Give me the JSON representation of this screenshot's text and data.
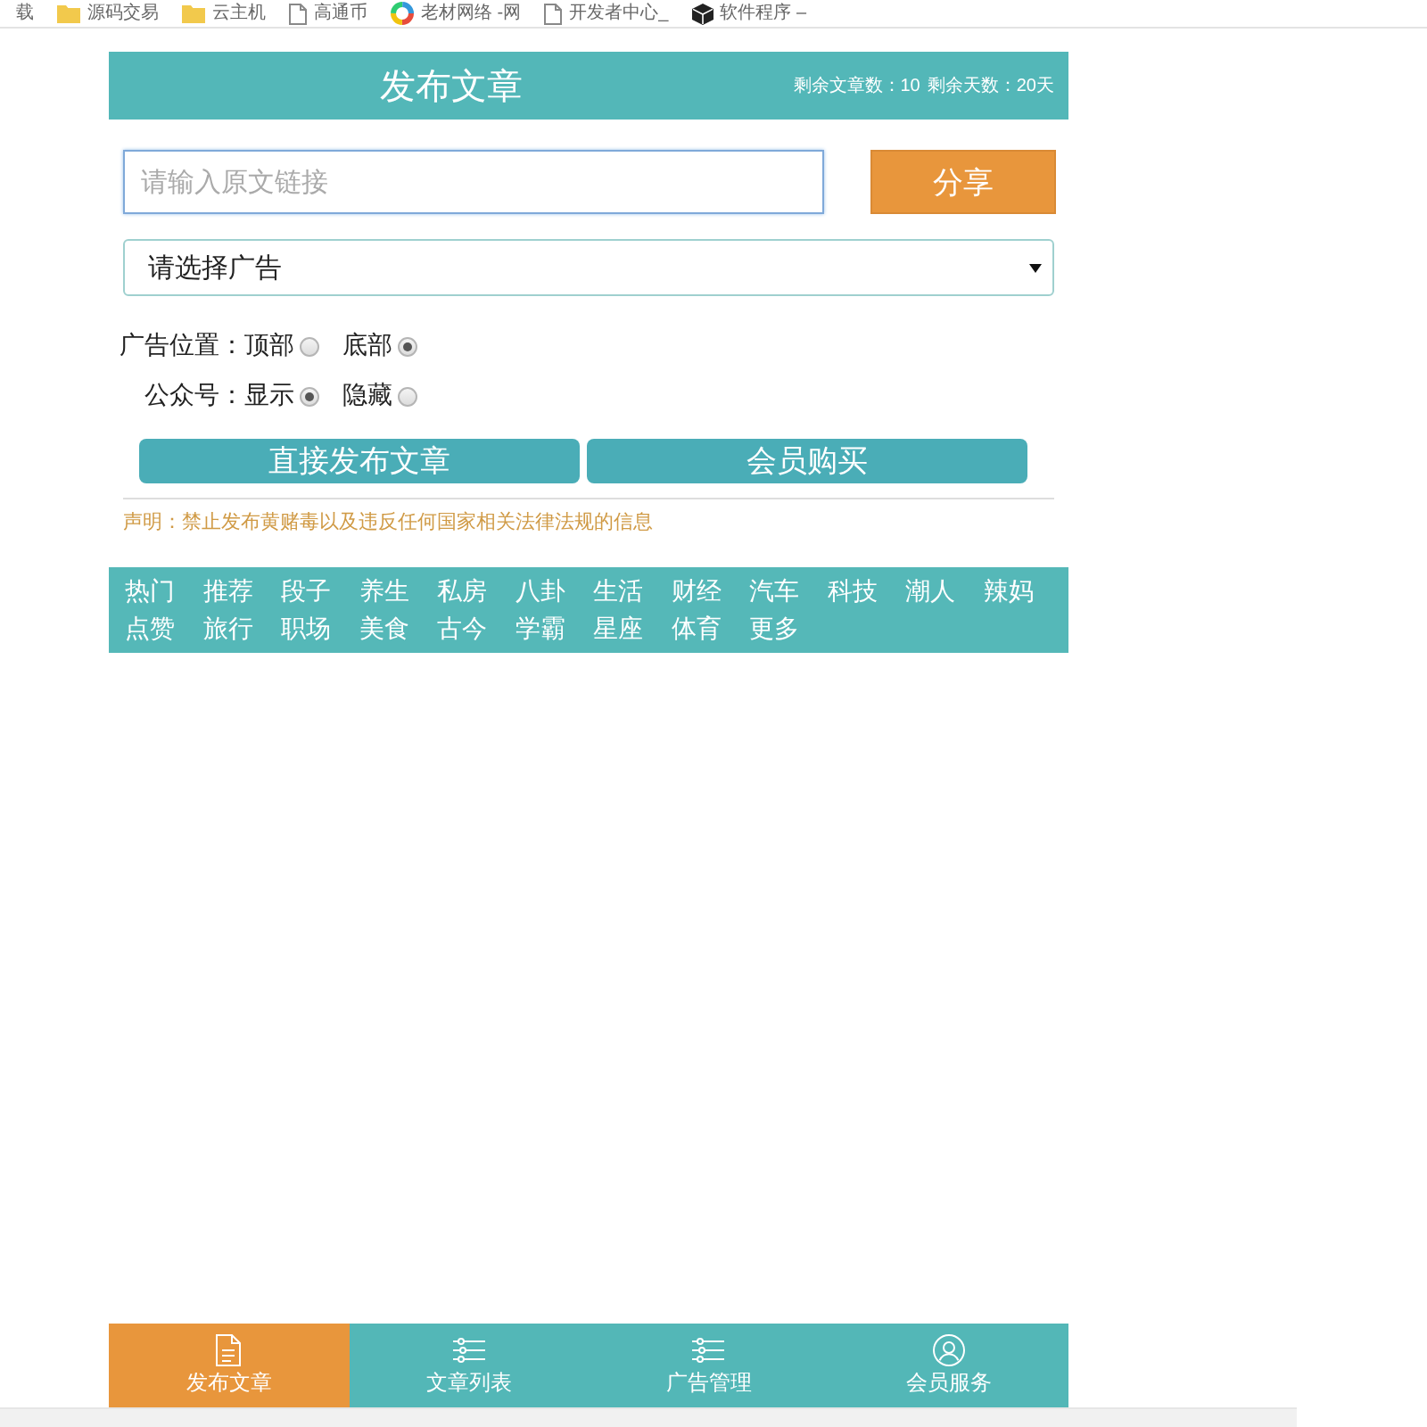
{
  "bookmarks": [
    {
      "kind": "plain",
      "label": "载"
    },
    {
      "kind": "folder",
      "label": "源码交易"
    },
    {
      "kind": "folder",
      "label": "云主机"
    },
    {
      "kind": "page",
      "label": "高通币"
    },
    {
      "kind": "ring",
      "label": "老材网络 -网"
    },
    {
      "kind": "page",
      "label": "开发者中心_"
    },
    {
      "kind": "cube",
      "label": "软件程序 –"
    }
  ],
  "header": {
    "title": "发布文章",
    "stats": [
      "剩余文章数：10",
      "剩余天数：20天"
    ]
  },
  "share_form": {
    "url_field": {
      "placeholder": "请输入原文链接"
    },
    "share_button": "分享"
  },
  "ad_select": {
    "value": "请选择广告"
  },
  "radio_groups": [
    {
      "label": "广告位置：",
      "options": [
        {
          "label": "顶部",
          "selected": false
        },
        {
          "label": "底部",
          "selected": true
        }
      ]
    },
    {
      "label": "公众号：",
      "options": [
        {
          "label": "显示",
          "selected": true
        },
        {
          "label": "隐藏",
          "selected": false
        }
      ]
    }
  ],
  "actions": [
    "直接发布文章",
    "会员购买"
  ],
  "notice": "声明：禁止发布黄赌毒以及违反任何国家相关法律法规的信息",
  "categories": [
    "热门",
    "推荐",
    "段子",
    "养生",
    "私房",
    "八卦",
    "生活",
    "财经",
    "汽车",
    "科技",
    "潮人",
    "辣妈",
    "点赞",
    "旅行",
    "职场",
    "美食",
    "古今",
    "学霸",
    "星座",
    "体育",
    "更多"
  ],
  "bottom_nav": [
    {
      "kind": "document",
      "label": "发布文章",
      "selected": true
    },
    {
      "kind": "list",
      "label": "文章列表",
      "selected": false
    },
    {
      "kind": "list",
      "label": "广告管理",
      "selected": false
    },
    {
      "kind": "user",
      "label": "会员服务",
      "selected": false
    }
  ]
}
